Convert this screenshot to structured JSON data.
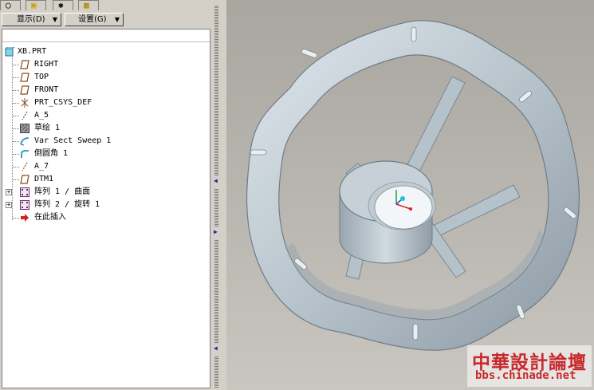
{
  "model_tree": {
    "toolbar": {
      "show_label": "显示(D)",
      "settings_label": "设置(G)"
    },
    "items": [
      {
        "label": "XB.PRT",
        "icon": "part-icon"
      },
      {
        "label": "RIGHT",
        "icon": "datum-plane-icon"
      },
      {
        "label": "TOP",
        "icon": "datum-plane-icon"
      },
      {
        "label": "FRONT",
        "icon": "datum-plane-icon"
      },
      {
        "label": "PRT_CSYS_DEF",
        "icon": "csys-icon"
      },
      {
        "label": "A_5",
        "icon": "datum-axis-icon"
      },
      {
        "label": "草绘 1",
        "icon": "sketch-icon"
      },
      {
        "label": "Var Sect Sweep 1",
        "icon": "sweep-icon"
      },
      {
        "label": "倒圆角 1",
        "icon": "round-icon"
      },
      {
        "label": "A_7",
        "icon": "datum-axis-icon"
      },
      {
        "label": "DTM1",
        "icon": "datum-plane-icon"
      },
      {
        "label": "阵列 1 / 曲面",
        "icon": "pattern-icon"
      },
      {
        "label": "阵列 2 / 旋转 1",
        "icon": "pattern-icon"
      },
      {
        "label": "在此插入",
        "icon": "insert-here-icon"
      }
    ]
  },
  "watermark": {
    "line1": "中華設計論壇",
    "line2": "bbs.chinade.net"
  },
  "colors": {
    "model": "#b8c4cc",
    "watermark": "#c8282a",
    "sash_arrow": "#1a2b8a"
  }
}
